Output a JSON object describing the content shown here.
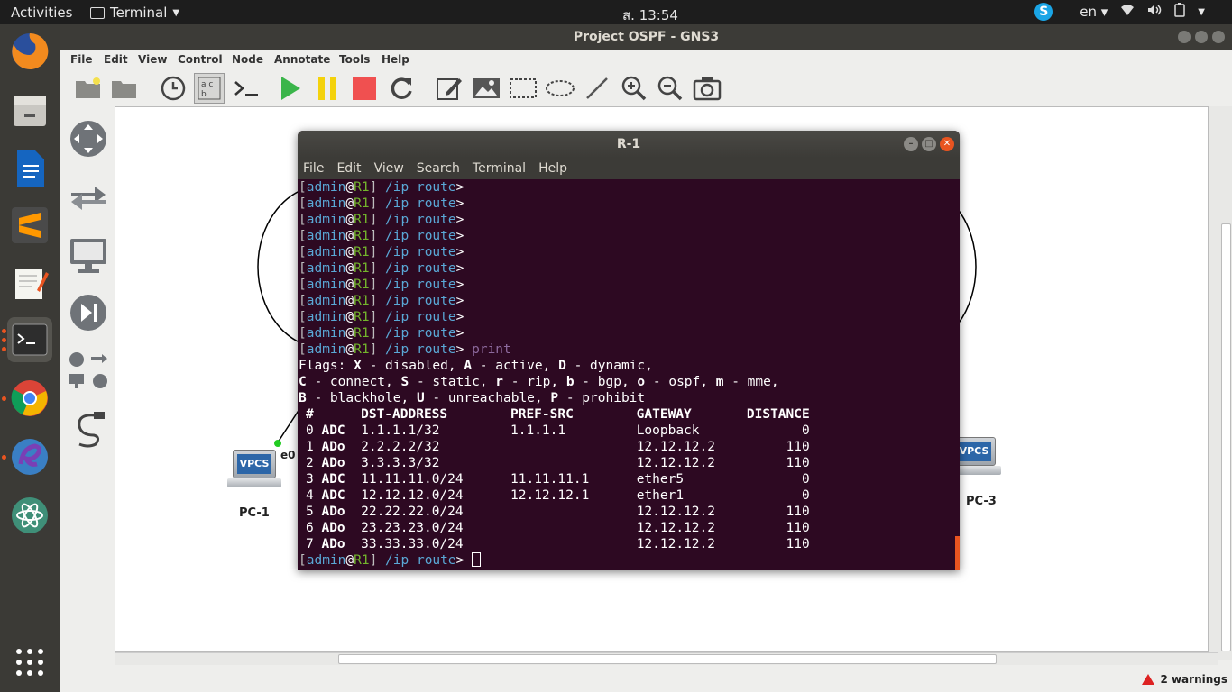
{
  "topbar": {
    "activities": "Activities",
    "app_name": "Terminal",
    "clock": "ส. 13:54",
    "lang": "en"
  },
  "gns3": {
    "title": "Project OSPF - GNS3",
    "menu": [
      "File",
      "Edit",
      "View",
      "Control",
      "Node",
      "Annotate",
      "Tools",
      "Help"
    ],
    "nodes": {
      "pc1": {
        "label": "PC-1",
        "screen": "VPCS",
        "iface": "e0"
      },
      "pc3": {
        "label": "PC-3",
        "screen": "VPCS"
      }
    },
    "status": {
      "warnings": "2 warnings"
    }
  },
  "terminal": {
    "title": "R-1",
    "menu": [
      "File",
      "Edit",
      "View",
      "Search",
      "Terminal",
      "Help"
    ],
    "prompt": {
      "user": "admin",
      "at": "@",
      "host": "R1",
      "path": " /ip route",
      "gt": ">"
    },
    "empty_prompts": 10,
    "command": "print",
    "flags": [
      [
        "Flags: ",
        "X",
        " - disabled, ",
        "A",
        " - active, ",
        "D",
        " - dynamic,"
      ],
      [
        "",
        "C",
        " - connect, ",
        "S",
        " - static, ",
        "r",
        " - rip, ",
        "b",
        " - bgp, ",
        "o",
        " - ospf, ",
        "m",
        " - mme,"
      ],
      [
        "",
        "B",
        " - blackhole, ",
        "U",
        " - unreachable, ",
        "P",
        " - prohibit"
      ]
    ],
    "columns": [
      "#",
      "DST-ADDRESS",
      "PREF-SRC",
      "GATEWAY",
      "DISTANCE"
    ],
    "routes": [
      {
        "n": "0",
        "flags": "ADC",
        "dst": "1.1.1.1/32",
        "src": "1.1.1.1",
        "gw": "Loopback",
        "dist": "0"
      },
      {
        "n": "1",
        "flags": "ADo",
        "dst": "2.2.2.2/32",
        "src": "",
        "gw": "12.12.12.2",
        "dist": "110"
      },
      {
        "n": "2",
        "flags": "ADo",
        "dst": "3.3.3.3/32",
        "src": "",
        "gw": "12.12.12.2",
        "dist": "110"
      },
      {
        "n": "3",
        "flags": "ADC",
        "dst": "11.11.11.0/24",
        "src": "11.11.11.1",
        "gw": "ether5",
        "dist": "0"
      },
      {
        "n": "4",
        "flags": "ADC",
        "dst": "12.12.12.0/24",
        "src": "12.12.12.1",
        "gw": "ether1",
        "dist": "0"
      },
      {
        "n": "5",
        "flags": "ADo",
        "dst": "22.22.22.0/24",
        "src": "",
        "gw": "12.12.12.2",
        "dist": "110"
      },
      {
        "n": "6",
        "flags": "ADo",
        "dst": "23.23.23.0/24",
        "src": "",
        "gw": "12.12.12.2",
        "dist": "110"
      },
      {
        "n": "7",
        "flags": "ADo",
        "dst": "33.33.33.0/24",
        "src": "",
        "gw": "12.12.12.2",
        "dist": "110"
      }
    ]
  },
  "dock": [
    "firefox-icon",
    "files-icon",
    "writer-icon",
    "sublime-icon",
    "text-editor-icon",
    "terminal-icon",
    "chrome-icon",
    "gns3-icon",
    "atom-icon",
    "app-grid-icon"
  ],
  "colors": {
    "accent": "#e95420",
    "terminal_bg": "#2d0922"
  }
}
